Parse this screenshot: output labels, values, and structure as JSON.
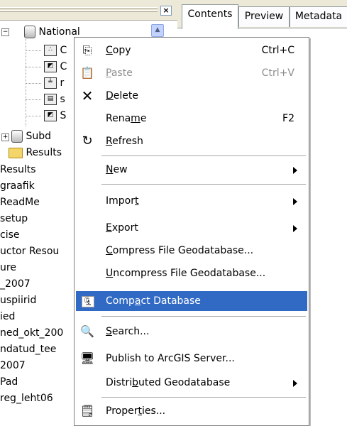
{
  "tabs": [
    "Contents",
    "Preview",
    "Metadata"
  ],
  "tree": {
    "root_label": "National",
    "children": [
      "C",
      "C",
      "r",
      "s",
      "S"
    ],
    "sibling_label": "Subd",
    "results_folder": "Results",
    "items": [
      "Results",
      "graafik",
      "ReadMe",
      "setup",
      "cise",
      "uctor Resou",
      "ure",
      "_2007",
      "uspiirid",
      "ied",
      "ned_okt_200",
      "ndatud_tee",
      "2007",
      "Pad",
      "reg_leht06"
    ]
  },
  "menu": {
    "copy": {
      "label": "Copy",
      "shortcut": "Ctrl+C",
      "accel": "C"
    },
    "paste": {
      "label": "Paste",
      "shortcut": "Ctrl+V",
      "accel": "P"
    },
    "delete": {
      "label": "Delete",
      "accel": "D"
    },
    "rename": {
      "label": "Rename",
      "shortcut": "F2"
    },
    "refresh": {
      "label": "Refresh"
    },
    "new": {
      "label": "New"
    },
    "import": {
      "label": "Import"
    },
    "export": {
      "label": "Export"
    },
    "compress": {
      "label": "Compress File Geodatabase..."
    },
    "uncompress": {
      "label": "Uncompress File Geodatabase..."
    },
    "compact": {
      "label": "Compact Database"
    },
    "search": {
      "label": "Search..."
    },
    "publish": {
      "label": "Publish to ArcGIS Server..."
    },
    "distributed": {
      "label": "Distributed Geodatabase"
    },
    "properties": {
      "label": "Properties..."
    }
  },
  "colors": {
    "highlight": "#316ac5",
    "disabled_text": "#8d8d8d",
    "chrome": "#ece9d8"
  }
}
